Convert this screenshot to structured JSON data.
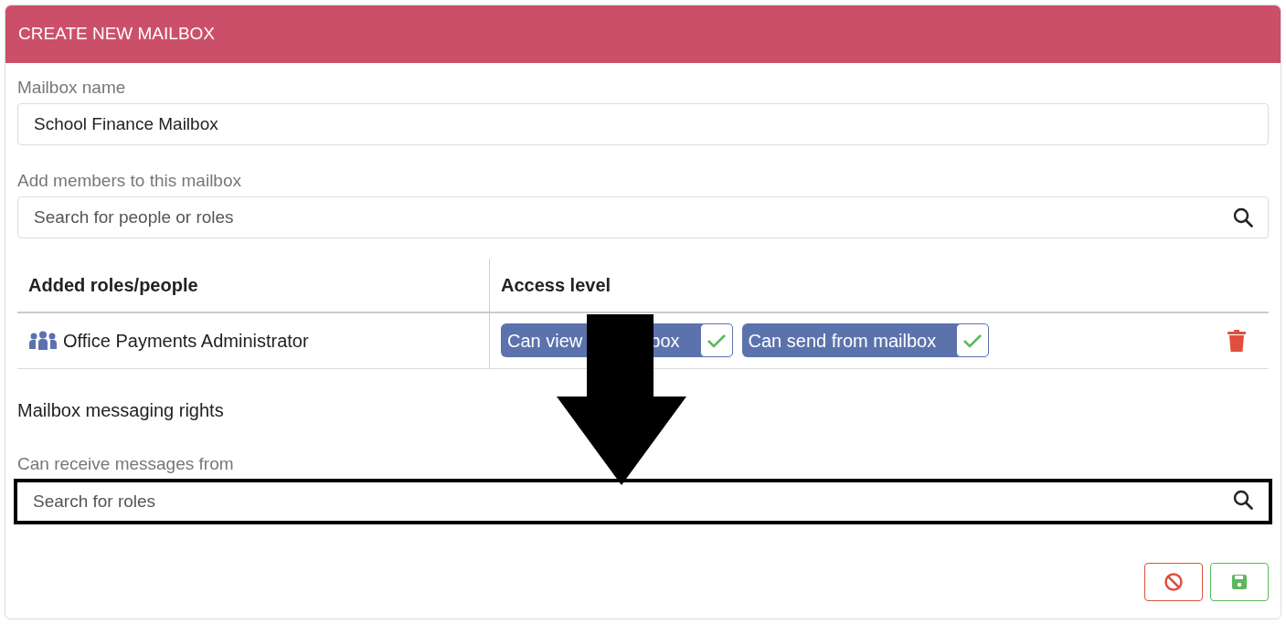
{
  "dialog": {
    "title": "CREATE NEW MAILBOX"
  },
  "name_field": {
    "label": "Mailbox name",
    "value": "School Finance Mailbox"
  },
  "members_field": {
    "label": "Add members to this mailbox",
    "placeholder": "Search for people or roles"
  },
  "table": {
    "columns": [
      "Added roles/people",
      "Access level"
    ],
    "rows": [
      {
        "name": "Office Payments Administrator",
        "kind": "role",
        "access": [
          {
            "label_parts": [
              "Can view",
              "box"
            ],
            "checked": true
          },
          {
            "label": "Can send from mailbox",
            "checked": true
          }
        ]
      }
    ]
  },
  "section_title": "Mailbox messaging rights",
  "receive_field": {
    "label": "Can receive messages from",
    "placeholder": "Search for roles",
    "highlighted": true
  },
  "pointer_arrow": true,
  "buttons": [
    {
      "kind": "cancel"
    },
    {
      "kind": "save"
    }
  ]
}
